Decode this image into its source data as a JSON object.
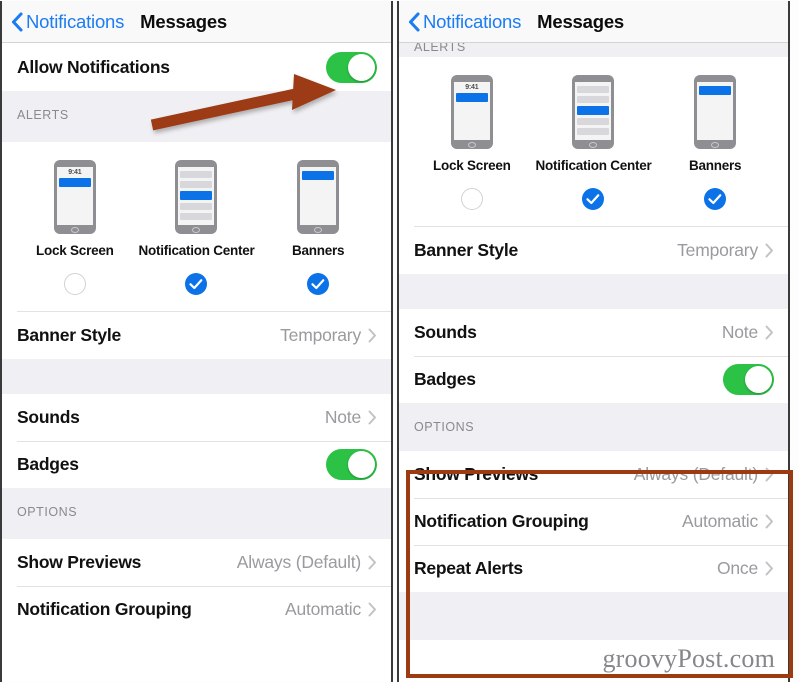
{
  "meta": {
    "watermark": "groovyPost.com",
    "accent_blue": "#0b72e8",
    "link_blue": "#1c7cf3",
    "toggle_green": "#2cc246",
    "annotation_brown": "#9c3a12"
  },
  "nav": {
    "back_label": "Notifications",
    "title": "Messages"
  },
  "left_panel": {
    "allow_row": {
      "label": "Allow Notifications",
      "toggle_on": true
    },
    "alerts_header": "ALERTS",
    "alert_styles": [
      {
        "caption": "Lock Screen",
        "selected": false,
        "time": "9:41"
      },
      {
        "caption": "Notification Center",
        "selected": true
      },
      {
        "caption": "Banners",
        "selected": true
      }
    ],
    "rows": [
      {
        "label": "Banner Style",
        "value": "Temporary",
        "type": "disclosure"
      },
      {
        "label": "Sounds",
        "value": "Note",
        "type": "disclosure"
      },
      {
        "label": "Badges",
        "value": "",
        "type": "toggle",
        "toggle_on": true
      }
    ],
    "options_header": "OPTIONS",
    "options_rows": [
      {
        "label": "Show Previews",
        "value": "Always (Default)",
        "type": "disclosure"
      },
      {
        "label": "Notification Grouping",
        "value": "Automatic",
        "type": "disclosure"
      }
    ]
  },
  "right_panel": {
    "clipped_header": "ALERTS",
    "alert_styles": [
      {
        "caption": "Lock Screen",
        "selected": false,
        "time": "9:41"
      },
      {
        "caption": "Notification Center",
        "selected": true
      },
      {
        "caption": "Banners",
        "selected": true
      }
    ],
    "rows": [
      {
        "label": "Banner Style",
        "value": "Temporary",
        "type": "disclosure"
      },
      {
        "label": "Sounds",
        "value": "Note",
        "type": "disclosure"
      },
      {
        "label": "Badges",
        "value": "",
        "type": "toggle",
        "toggle_on": true
      }
    ],
    "options_header": "OPTIONS",
    "options_rows": [
      {
        "label": "Show Previews",
        "value": "Always (Default)",
        "type": "disclosure"
      },
      {
        "label": "Notification Grouping",
        "value": "Automatic",
        "type": "disclosure"
      },
      {
        "label": "Repeat Alerts",
        "value": "Once",
        "type": "disclosure"
      }
    ]
  }
}
